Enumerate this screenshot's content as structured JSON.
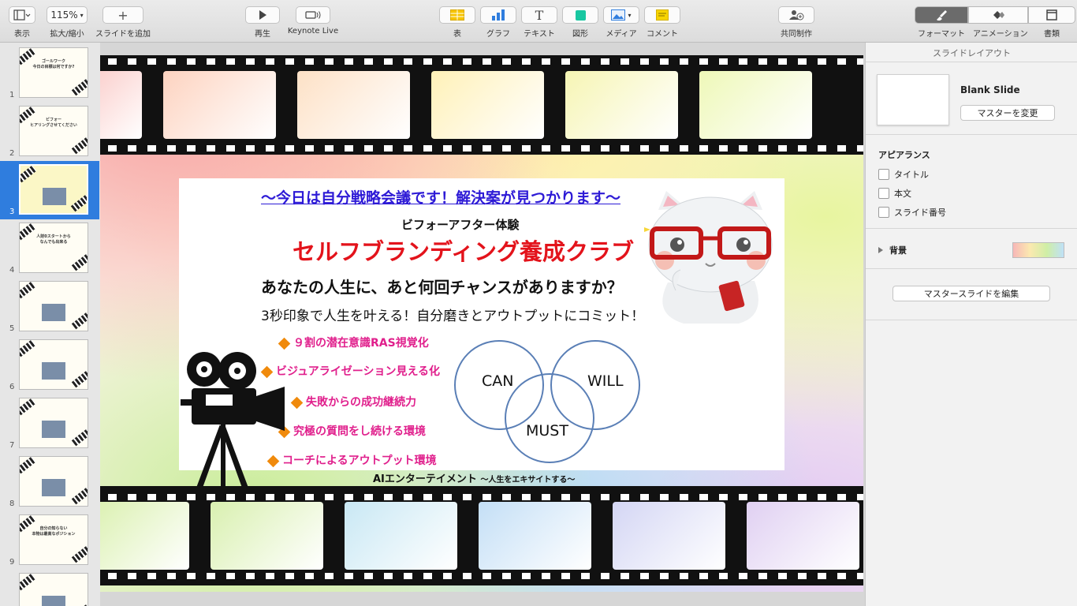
{
  "toolbar": {
    "view": "表示",
    "zoom_value": "115%",
    "zoom": "拡大/縮小",
    "add_slide": "スライドを追加",
    "play": "再生",
    "keynote_live": "Keynote Live",
    "table": "表",
    "chart": "グラフ",
    "text": "テキスト",
    "shape": "図形",
    "media": "メディア",
    "comment": "コメント",
    "collaborate": "共同制作",
    "format": "フォーマット",
    "animate": "アニメーション",
    "document": "書類"
  },
  "navigator": {
    "slides": [
      {
        "num": "1",
        "title": "ゴールワーク\n今日の目標は何ですか?"
      },
      {
        "num": "2",
        "title": "ビフォー\nヒアリングさせてください"
      },
      {
        "num": "3",
        "title": "",
        "selected": true
      },
      {
        "num": "4",
        "title": "人財0スタートから\nなんでも出来る"
      },
      {
        "num": "5",
        "title": ""
      },
      {
        "num": "6",
        "title": ""
      },
      {
        "num": "7",
        "title": ""
      },
      {
        "num": "8",
        "title": ""
      },
      {
        "num": "9",
        "title": "自分の知らない\n本物は最高なポジション"
      },
      {
        "num": "",
        "title": ""
      }
    ]
  },
  "slide": {
    "headline": "〜今日は自分戦略会議です！解決案が見つかります〜",
    "sub": "ビフォーアフター体験",
    "brand": "セルフブランディング養成クラブ",
    "question": "あなたの人生に、あと何回チャンスがありますか？",
    "tagline": "3秒印象で人生を叶える！自分磨きとアウトプットにコミット！",
    "bullets": [
      "９割の潜在意識RAS視覚化",
      "ビジュアライゼーション見える化",
      "失敗からの成功継続力",
      "究極の質問をし続ける環境",
      "コーチによるアウトプット環境"
    ],
    "venn": {
      "can": "CAN",
      "will": "WILL",
      "must": "MUST"
    },
    "footer_main": "AIエンターテイメント",
    "footer_small": "〜人生をエキサイトする〜"
  },
  "inspector": {
    "header": "スライドレイアウト",
    "layout_name": "Blank Slide",
    "change_master": "マスターを変更",
    "appearance": "アピアランス",
    "title_check": "タイトル",
    "body_check": "本文",
    "slide_number_check": "スライド番号",
    "background": "背景",
    "edit_master": "マスタースライドを編集"
  },
  "colors": {
    "selection": "#2f7dde",
    "headline": "#2d1ad6",
    "brand": "#e3131b",
    "bullet": "#e01f8c",
    "venn": "#5a7fb6"
  }
}
